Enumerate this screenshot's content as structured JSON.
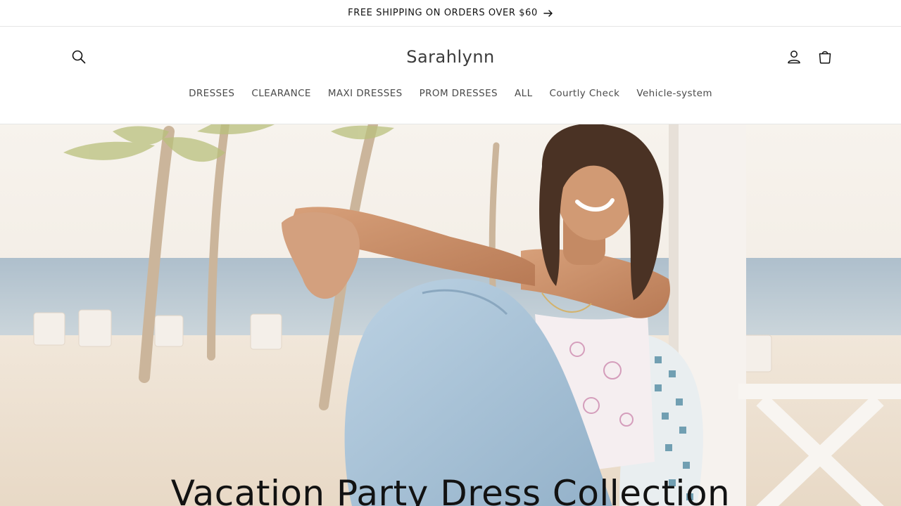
{
  "announcement": {
    "text": "FREE SHIPPING ON ORDERS OVER $60",
    "icon": "arrow-right-icon"
  },
  "header": {
    "logo": "Sarahlynn",
    "icons": {
      "search": "search-icon",
      "account": "account-icon",
      "cart": "cart-icon"
    }
  },
  "nav": {
    "items": [
      {
        "label": "DRESSES"
      },
      {
        "label": "CLEARANCE"
      },
      {
        "label": "MAXI DRESSES"
      },
      {
        "label": "PROM DRESSES"
      },
      {
        "label": "ALL"
      },
      {
        "label": "Courtly Check"
      },
      {
        "label": "Vehicle-system"
      }
    ]
  },
  "hero": {
    "title": "Vacation Party Dress Collection",
    "image": "woman-on-beach-image"
  },
  "colors": {
    "text": "#121212",
    "border": "#e6e6e6",
    "sky": "#f3efe8",
    "sea": "#b9cbd8",
    "sand": "#efe4d6",
    "denim": "#a9c3d8"
  }
}
